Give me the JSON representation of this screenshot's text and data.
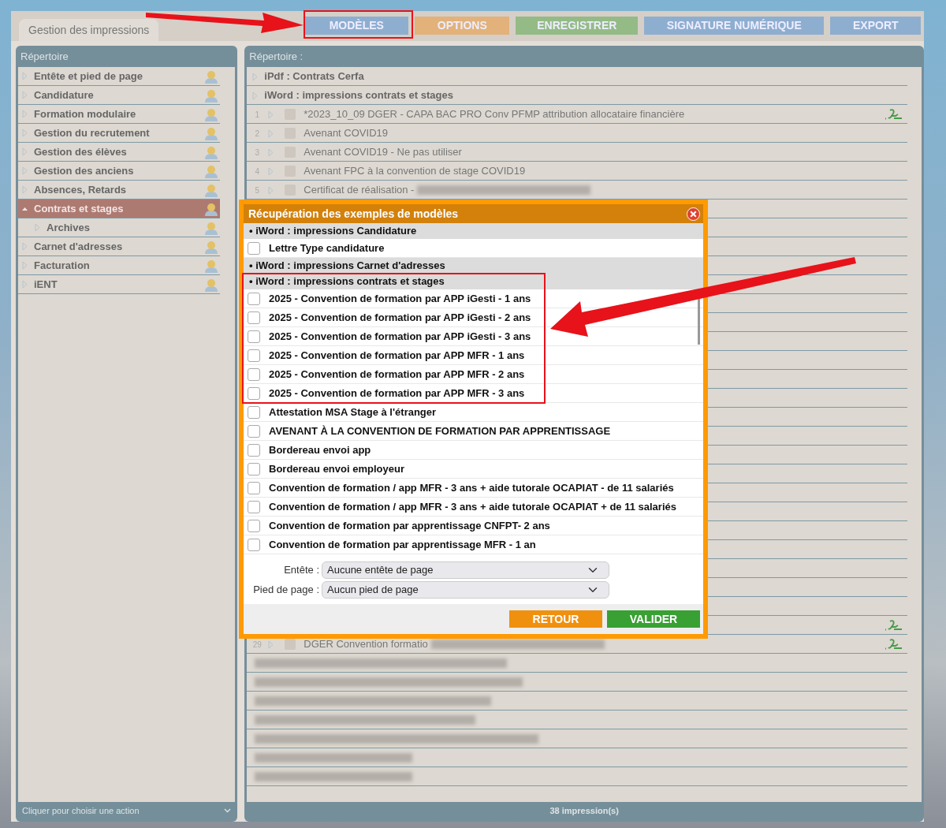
{
  "window_tab": "Gestion des impressions",
  "toolbar": [
    {
      "label": "MODÈLES",
      "color": "#8eaed0"
    },
    {
      "label": "OPTIONS",
      "color": "#e2b27a"
    },
    {
      "label": "ENREGISTRER",
      "color": "#94bb86"
    },
    {
      "label": "SIGNATURE NUMÉRIQUE",
      "color": "#8eaed0"
    },
    {
      "label": "EXPORT",
      "color": "#8eaed0"
    }
  ],
  "sidebar": {
    "title": "Répertoire",
    "items": [
      {
        "label": "Entête et pied de page",
        "expanded": false,
        "selected": false
      },
      {
        "label": "Candidature",
        "expanded": false,
        "selected": false
      },
      {
        "label": "Formation modulaire",
        "expanded": false,
        "selected": false
      },
      {
        "label": "Gestion du recrutement",
        "expanded": false,
        "selected": false
      },
      {
        "label": "Gestion des élèves",
        "expanded": false,
        "selected": false
      },
      {
        "label": "Gestion des anciens",
        "expanded": false,
        "selected": false
      },
      {
        "label": "Absences, Retards",
        "expanded": false,
        "selected": false
      },
      {
        "label": "Contrats et stages",
        "expanded": true,
        "selected": true,
        "children": [
          {
            "label": "Archives",
            "expanded": false,
            "selected": false
          }
        ]
      },
      {
        "label": "Carnet d'adresses",
        "expanded": false,
        "selected": false
      },
      {
        "label": "Facturation",
        "expanded": false,
        "selected": false
      },
      {
        "label": "iENT",
        "expanded": false,
        "selected": false
      }
    ],
    "footer": "Cliquer pour choisir une action"
  },
  "list": {
    "title": "Répertoire :",
    "groups": [
      {
        "label": "iPdf : Contrats Cerfa"
      },
      {
        "label": "iWord : impressions contrats et stages"
      }
    ],
    "rows": [
      {
        "kind": "item",
        "number": "1",
        "checked": false,
        "title": "*2023_10_09 DGER - CAPA BAC PRO Conv PFMP attribution allocataire financière",
        "signature": true,
        "redacted": false
      },
      {
        "kind": "item",
        "number": "2",
        "checked": false,
        "title": "Avenant COVID19",
        "signature": false,
        "redacted": false
      },
      {
        "kind": "item",
        "number": "3",
        "checked": false,
        "title": "Avenant COVID19 - Ne pas utiliser",
        "signature": false,
        "redacted": false
      },
      {
        "kind": "item",
        "number": "4",
        "checked": false,
        "title": "Avenant FPC à la convention de stage COVID19",
        "signature": false,
        "redacted": false
      },
      {
        "kind": "item",
        "number": "5",
        "checked": false,
        "title": "Certificat de réalisation -",
        "signature": false,
        "redacted": true
      },
      {
        "kind": "covered",
        "signature": true
      },
      {
        "kind": "item",
        "number": "29",
        "checked": false,
        "title": "DGER Convention formatio",
        "signature": true,
        "redacted": true
      },
      {
        "kind": "blurred",
        "signature": false
      },
      {
        "kind": "blurred",
        "signature": false
      },
      {
        "kind": "blurred",
        "signature": false
      },
      {
        "kind": "blurred",
        "signature": false
      },
      {
        "kind": "blurred",
        "signature": false
      },
      {
        "kind": "blurred",
        "signature": false
      },
      {
        "kind": "blurred",
        "signature": false
      }
    ],
    "footer": "38 impression(s)"
  },
  "modal": {
    "title": "Récupération des exemples de modèles",
    "items": [
      {
        "kind": "group",
        "label": "• iWord : impressions Candidature"
      },
      {
        "kind": "option",
        "label": "Lettre Type candidature",
        "checked": false
      },
      {
        "kind": "group",
        "label": "• iWord : impressions Carnet d'adresses"
      },
      {
        "kind": "group",
        "label": "• iWord : impressions contrats et stages"
      },
      {
        "kind": "option",
        "label": "2025 - Convention de formation par APP iGesti - 1 ans",
        "checked": false
      },
      {
        "kind": "option",
        "label": "2025 - Convention de formation par APP iGesti - 2 ans",
        "checked": false
      },
      {
        "kind": "option",
        "label": "2025 - Convention de formation par APP iGesti - 3 ans",
        "checked": false
      },
      {
        "kind": "option",
        "label": "2025 - Convention de formation par APP MFR - 1 ans",
        "checked": false
      },
      {
        "kind": "option",
        "label": "2025 - Convention de formation par APP MFR - 2 ans",
        "checked": false
      },
      {
        "kind": "option",
        "label": "2025 - Convention de formation par APP MFR - 3 ans",
        "checked": false
      },
      {
        "kind": "option",
        "label": "Attestation MSA Stage à l'étranger",
        "checked": false
      },
      {
        "kind": "option",
        "label": "AVENANT À LA CONVENTION DE FORMATION PAR APPRENTISSAGE",
        "checked": false
      },
      {
        "kind": "option",
        "label": "Bordereau envoi app",
        "checked": false
      },
      {
        "kind": "option",
        "label": "Bordereau envoi employeur",
        "checked": false
      },
      {
        "kind": "option",
        "label": "Convention de formation / app MFR - 3 ans + aide tutorale OCAPIAT - de 11 salariés",
        "checked": false
      },
      {
        "kind": "option",
        "label": "Convention de formation / app MFR - 3 ans + aide tutorale OCAPIAT + de 11 salariés",
        "checked": false
      },
      {
        "kind": "option",
        "label": "Convention de formation par apprentissage CNFPT- 2 ans",
        "checked": false
      },
      {
        "kind": "option",
        "label": "Convention de formation par apprentissage MFR - 1 an",
        "checked": false
      }
    ],
    "fields": [
      {
        "label": "Entête :",
        "value": "Aucune entête de page"
      },
      {
        "label": "Pied de page :",
        "value": "Aucun pied de page"
      }
    ],
    "buttons": [
      {
        "kind": "back",
        "label": "RETOUR"
      },
      {
        "kind": "confirm",
        "label": "VALIDER"
      }
    ]
  }
}
